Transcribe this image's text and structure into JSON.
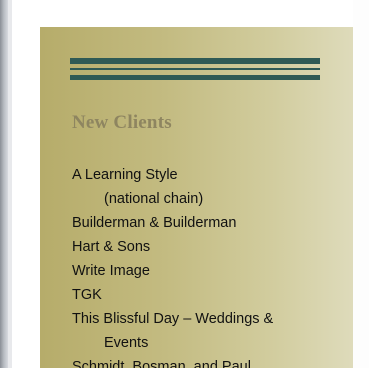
{
  "sidebar": {
    "heading": "New Clients",
    "lines": [
      "A Learning Style",
      "(national chain)",
      "Builderman & Builderman",
      "Hart & Sons",
      "Write Image",
      "TGK",
      "This Blissful Day – Weddings &",
      "Events",
      "Schmidt, Bosman, and Paul"
    ]
  },
  "colors": {
    "sidebar_gradient_start": "#b6ac6a",
    "sidebar_gradient_end": "#dedbbb",
    "rule_color": "#2f5a55",
    "heading_color": "#8e8560",
    "text_color": "#111111"
  }
}
